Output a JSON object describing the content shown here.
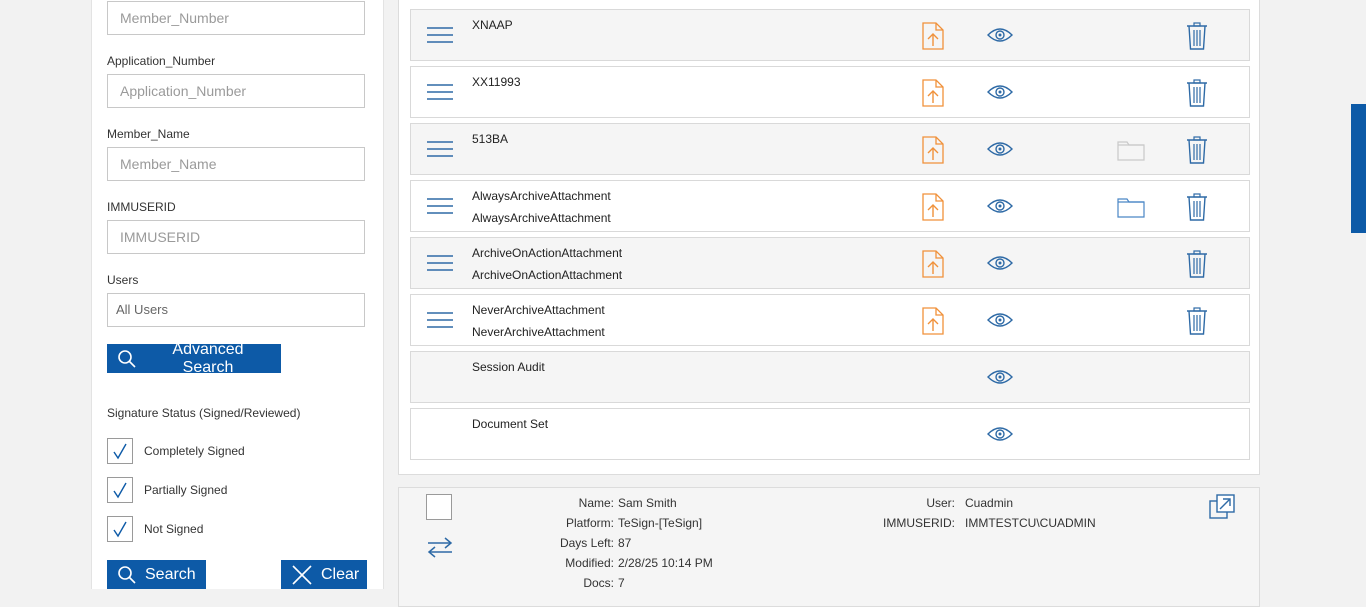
{
  "filters": {
    "member_number": {
      "label": "",
      "placeholder": "Member_Number"
    },
    "application_number": {
      "label": "Application_Number",
      "placeholder": "Application_Number"
    },
    "member_name": {
      "label": "Member_Name",
      "placeholder": "Member_Name"
    },
    "immuserid": {
      "label": "IMMUSERID",
      "placeholder": "IMMUSERID"
    },
    "users": {
      "label": "Users",
      "value": "All Users"
    },
    "advanced_search_label": "Advanced Search",
    "signature_status_title": "Signature Status (Signed/Reviewed)",
    "signature_options": [
      {
        "label": "Completely Signed",
        "checked": true
      },
      {
        "label": "Partially Signed",
        "checked": true
      },
      {
        "label": "Not Signed",
        "checked": true
      }
    ],
    "search_label": "Search",
    "clear_label": "Clear"
  },
  "documents": [
    {
      "line1": "XNAAP",
      "line2": "",
      "menu": true,
      "upload": true,
      "view": true,
      "folder": "",
      "delete": true
    },
    {
      "line1": "XX11993",
      "line2": "",
      "menu": true,
      "upload": true,
      "view": true,
      "folder": "",
      "delete": true
    },
    {
      "line1": "513BA",
      "line2": "",
      "menu": true,
      "upload": true,
      "view": true,
      "folder": "disabled",
      "delete": true
    },
    {
      "line1": "AlwaysArchiveAttachment",
      "line2": "AlwaysArchiveAttachment",
      "menu": true,
      "upload": true,
      "view": true,
      "folder": "enabled",
      "delete": true
    },
    {
      "line1": "ArchiveOnActionAttachment",
      "line2": "ArchiveOnActionAttachment",
      "menu": true,
      "upload": true,
      "view": true,
      "folder": "",
      "delete": true
    },
    {
      "line1": "NeverArchiveAttachment",
      "line2": "NeverArchiveAttachment",
      "menu": true,
      "upload": true,
      "view": true,
      "folder": "",
      "delete": true
    },
    {
      "line1": "Session Audit",
      "line2": "",
      "menu": false,
      "upload": false,
      "view": true,
      "folder": "",
      "delete": false
    },
    {
      "line1": "Document Set",
      "line2": "",
      "menu": false,
      "upload": false,
      "view": true,
      "folder": "",
      "delete": false
    }
  ],
  "session_info": {
    "name_key": "Name:",
    "name": "Sam Smith",
    "platform_key": "Platform:",
    "platform": "TeSign-[TeSign]",
    "days_left_key": "Days Left:",
    "days_left": "87",
    "modified_key": "Modified:",
    "modified": "2/28/25 10:14 PM",
    "docs_key": "Docs:",
    "docs": "7",
    "user_key": "User:",
    "user": "Cuadmin",
    "immuserid_key": "IMMUSERID:",
    "immuserid": "IMMTESTCU\\CUADMIN"
  },
  "icons": {
    "menu": "hamburger-icon",
    "upload": "upload-file-icon",
    "view": "eye-icon",
    "folder": "folder-icon",
    "delete": "trash-icon",
    "transfer": "transfer-arrows-icon",
    "open_external": "open-external-icon",
    "search": "magnifier-icon",
    "clear": "close-x-icon"
  },
  "colors": {
    "primary": "#0d5aa7",
    "accent_orange": "#f0913a",
    "icon_blue": "#2e6aa6",
    "folder_disabled": "#c9c9c9",
    "folder_enabled": "#4a86c5"
  }
}
